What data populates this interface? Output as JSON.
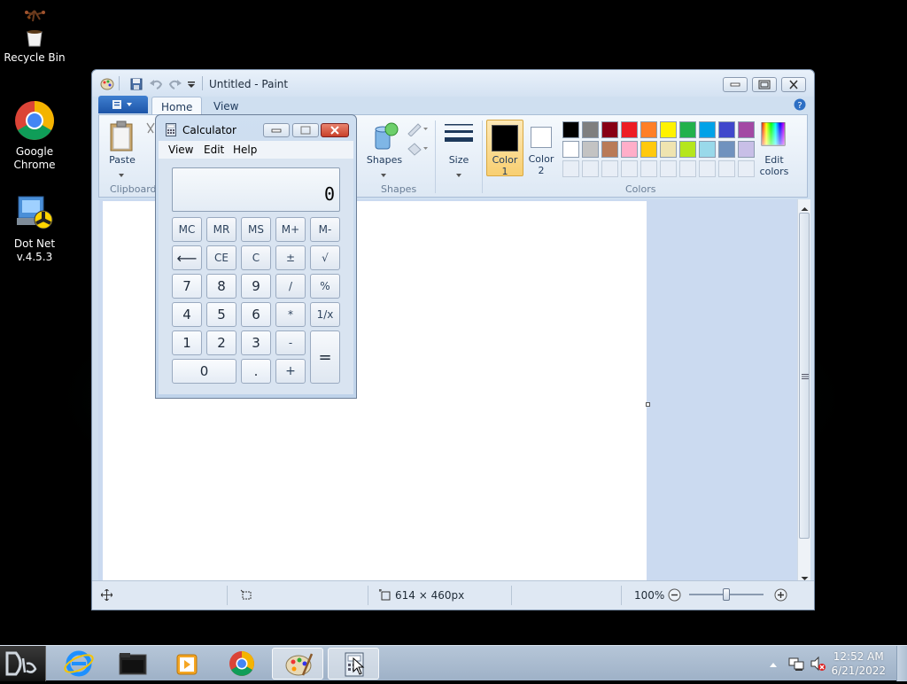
{
  "desktop": {
    "icons": [
      {
        "label": "Recycle Bin"
      },
      {
        "label": "Google Chrome"
      },
      {
        "label": "Dot Net v.4.5.3"
      }
    ]
  },
  "paint": {
    "title": "Untitled - Paint",
    "tabs": [
      "Home",
      "View"
    ],
    "ribbon": {
      "paste_label": "Paste",
      "clipboard_label": "Clipboard",
      "shapes_label": "Shapes",
      "shapes_group_label": "Shapes",
      "size_label": "Size",
      "color1_label": "Color\n1",
      "color1_line1": "Color",
      "color1_line2": "1",
      "color2_line1": "Color",
      "color2_line2": "2",
      "edit_colors_line1": "Edit",
      "edit_colors_line2": "colors",
      "colors_group_label": "Colors",
      "color1_value": "#000000",
      "color2_value": "#ffffff",
      "palette_row1": [
        "#000000",
        "#7f7f7f",
        "#880015",
        "#ed1c24",
        "#ff7f27",
        "#fff200",
        "#22b14c",
        "#00a2e8",
        "#3f48cc",
        "#a349a4"
      ],
      "palette_row2": [
        "#ffffff",
        "#c3c3c3",
        "#b97a57",
        "#ffaec9",
        "#ffc90e",
        "#efe4b0",
        "#b5e61d",
        "#99d9ea",
        "#7092be",
        "#c8bfe7"
      ]
    },
    "status": {
      "canvas_size": "614 × 460px",
      "zoom": "100%"
    }
  },
  "calculator": {
    "title": "Calculator",
    "menu": [
      "View",
      "Edit",
      "Help"
    ],
    "display": "0",
    "buttons": {
      "mc": "MC",
      "mr": "MR",
      "ms": "MS",
      "mplus": "M+",
      "mminus": "M-",
      "back": "⟵",
      "ce": "CE",
      "c": "C",
      "plusminus": "±",
      "sqrt": "√",
      "n7": "7",
      "n8": "8",
      "n9": "9",
      "div": "/",
      "pct": "%",
      "n4": "4",
      "n5": "5",
      "n6": "6",
      "mul": "*",
      "recip": "1/x",
      "n1": "1",
      "n2": "2",
      "n3": "3",
      "sub": "-",
      "eq": "=",
      "n0": "0",
      "dot": ".",
      "add": "+"
    }
  },
  "taskbar": {
    "time": "12:52 AM",
    "date": "6/21/2022"
  }
}
